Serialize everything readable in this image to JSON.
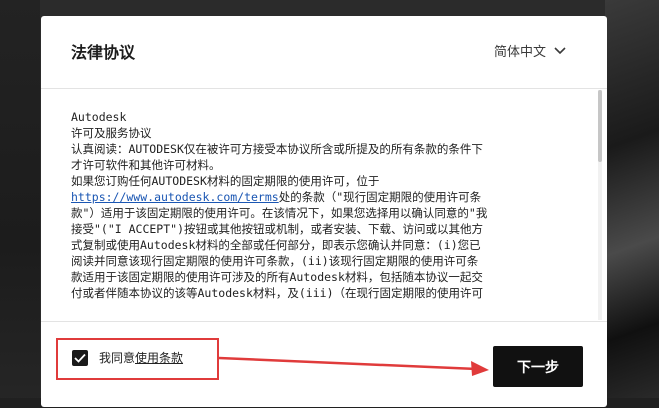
{
  "dialog": {
    "title": "法律协议",
    "language": "简体中文",
    "terms_lines": [
      "Autodesk",
      "许可及服务协议",
      "认真阅读：AUTODESK仅在被许可方接受本协议所含或所提及的所有条款的条件下",
      "才许可软件和其他许可材料。",
      "如果您订购任何AUTODESK材料的固定期限的使用许可，位于",
      "https://www.autodesk.com/terms处的条款（\"现行固定期限的使用许可条",
      "款\"）适用于该固定期限的使用许可。在该情况下，如果您选择用以确认同意的\"我",
      "接受\"(\"I ACCEPT\")按钮或其他按钮或机制，或者安装、下载、访问或以其他方",
      "式复制或使用Autodesk材料的全部或任何部分，即表示您确认并同意：(i)您已",
      "阅读并同意该现行固定期限的使用许可条款，(ii)该现行固定期限的使用许可条",
      "款适用于该固定期限的使用许可涉及的所有Autodesk材料，包括随本协议一起交",
      "付或者伴随本协议的该等Autodesk材料，及(iii)（在现行固定期限的使用许可"
    ],
    "terms_link_text": "https://www.autodesk.com/terms",
    "agree_prefix": "我同意",
    "agree_link": "使用条款",
    "next_label": "下一步"
  },
  "colors": {
    "highlight": "#e03b3b",
    "link": "#1a56b3",
    "button": "#111111"
  }
}
